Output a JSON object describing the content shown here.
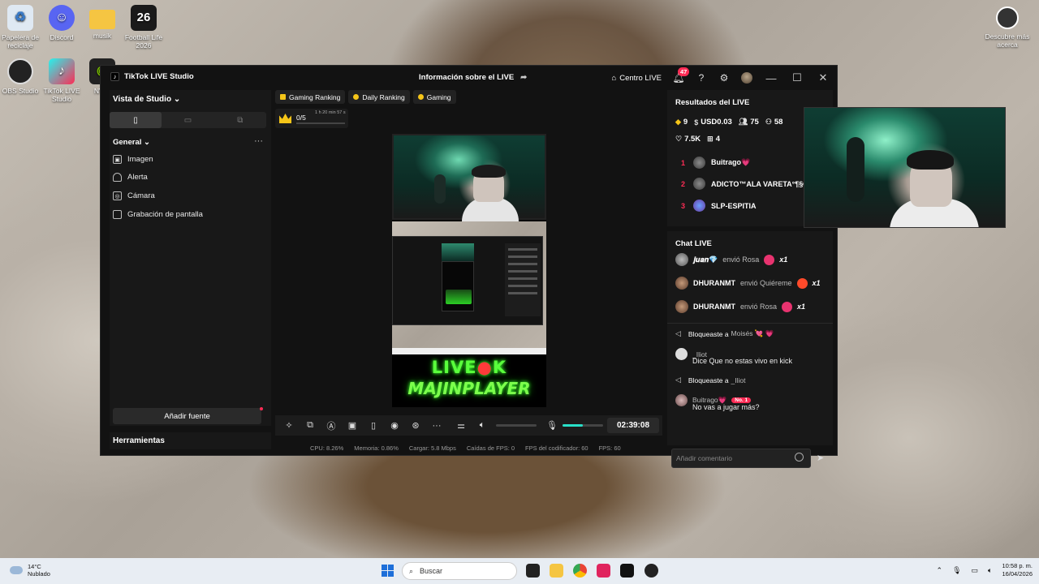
{
  "desktop": {
    "icons": [
      {
        "label": "Papelera de reciclaje",
        "icon": "recycle-bin-icon",
        "color": "#5fa8e8"
      },
      {
        "label": "Discord",
        "icon": "discord-icon",
        "color": "#5865f2"
      },
      {
        "label": "musik",
        "icon": "folder-icon",
        "color": "#f5c542"
      },
      {
        "label": "Football Life 2026",
        "icon": "game-icon",
        "glyph": "26",
        "color": "#c0101a"
      },
      {
        "label": "OBS Studio",
        "icon": "obs-icon",
        "color": "#1e1e1e"
      },
      {
        "label": "TikTok LIVE Studio",
        "icon": "tiktok-icon",
        "color": "#fe2c55"
      },
      {
        "label": "NVID",
        "icon": "nvidia-icon",
        "color": "#76b900"
      }
    ],
    "right_icon": {
      "label": "Descubre más acerca",
      "icon": "spotlight-icon"
    }
  },
  "window": {
    "app_name": "TikTok LIVE Studio",
    "center_title": "Información sobre el LIVE",
    "centro_live": "Centro LIVE",
    "notification_count": "47"
  },
  "left": {
    "studio_view": "Vista de Studio",
    "section_title": "General",
    "sources": [
      {
        "label": "Imagen",
        "icon": "image-icon"
      },
      {
        "label": "Alerta",
        "icon": "bell-icon"
      },
      {
        "label": "Cámara",
        "icon": "camera-icon"
      },
      {
        "label": "Grabación de pantalla",
        "icon": "monitor-icon"
      }
    ],
    "add_source": "Añadir fuente",
    "tools": "Herramientas"
  },
  "center": {
    "chips": [
      "Gaming Ranking",
      "Daily Ranking",
      "Gaming"
    ],
    "goal_count": "0/5",
    "goal_time": "1 h 20 min 57 s",
    "overlay": {
      "line1_a": "LIVE",
      "line1_b": "K",
      "line2": "MAJINPLAYER"
    },
    "timer": "02:39:08",
    "stats": {
      "cpu": "CPU:  8.26%",
      "memory": "Memoria:  0.86%",
      "upload": "Cargar:  5.8 Mbps",
      "fps_drops": "Caídas de FPS:  0",
      "encoder_fps": "FPS del codificador:  60",
      "fps": "FPS:  60"
    },
    "mic_level": 0.5
  },
  "results": {
    "title": "Resultados del LIVE",
    "diamonds": "9",
    "usd": "USD0.03",
    "viewers": "75",
    "new_followers": "58",
    "likes": "7.5K",
    "gifters": "4",
    "ranking": [
      {
        "rank": "1",
        "name": "Buitrago💗"
      },
      {
        "rank": "2",
        "name": "ADICTO™ALA VARETA°¶§®"
      },
      {
        "rank": "3",
        "name": "SLP-ESPITIA"
      }
    ]
  },
  "chat": {
    "title": "Chat LIVE",
    "gifts": [
      {
        "user": "𝒋𝒖𝒂𝒏💎",
        "action": "envió Rosa",
        "count": "x1",
        "gift_color": "#e8336f"
      },
      {
        "user": "DHURANMT",
        "action": "envió Quiéreme",
        "count": "x1",
        "gift_color": "#ff4a2a"
      },
      {
        "user": "DHURANMT",
        "action": "envió Rosa",
        "count": "x1",
        "gift_color": "#e8336f"
      }
    ],
    "block1": {
      "text": "Bloqueaste a",
      "user": "Moisés 💘 💗"
    },
    "comment1": {
      "user": "_Iliot",
      "text": "Dice Que no estas vivo en kick"
    },
    "block2": {
      "text": "Bloqueaste a",
      "user": "_Iliot"
    },
    "comment2": {
      "user": "Buitrago💗",
      "badge": "No. 1",
      "text": "No vas a jugar más?"
    },
    "input_placeholder": "Añadir comentario"
  },
  "taskbar": {
    "temp": "14°C",
    "weather": "Nublado",
    "search": "Buscar",
    "time": "10:58 p. m.",
    "date": "16/04/2026"
  },
  "colors": {
    "accent": "#fe2c55",
    "live_green": "#5aff3c",
    "mic_fill": "#28e0c8"
  }
}
